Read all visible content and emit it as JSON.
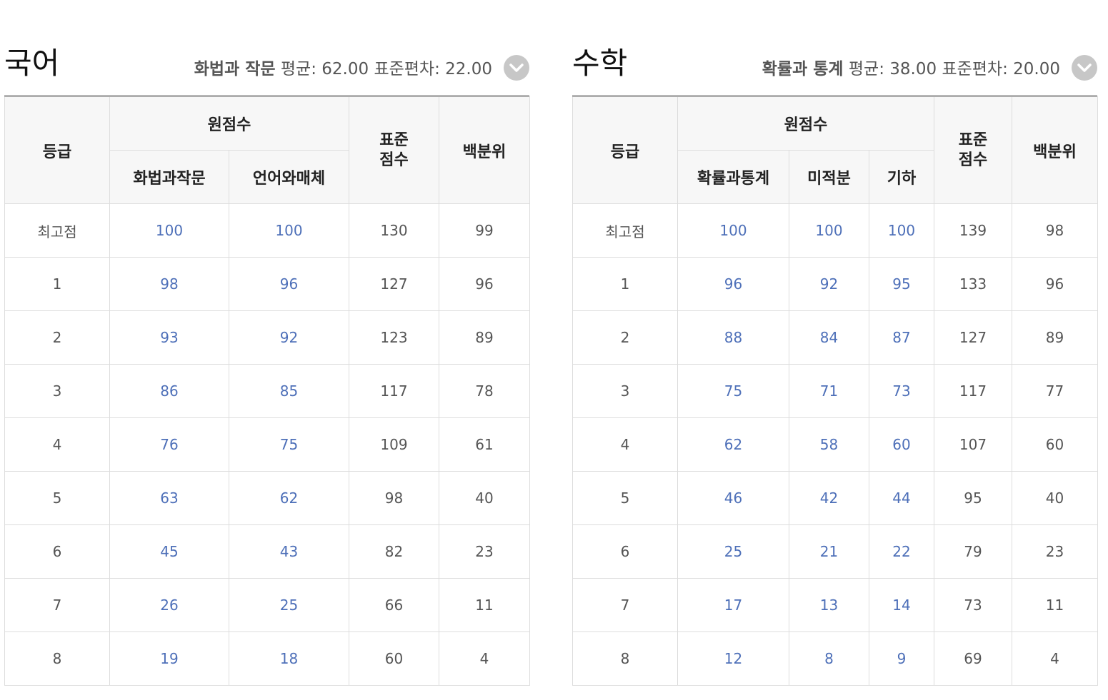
{
  "korean": {
    "title": "국어",
    "elective": "화법과 작문",
    "mean_label": "평균:",
    "mean": "62.00",
    "sd_label": "표준편차:",
    "sd": "22.00",
    "headers": {
      "grade": "등급",
      "raw_score": "원점수",
      "sub_cols": [
        "화법과작문",
        "언어와매체"
      ],
      "std_score_line1": "표준",
      "std_score_line2": "점수",
      "percentile": "백분위"
    },
    "rows": [
      {
        "grade": "최고점",
        "raw": [
          "100",
          "100"
        ],
        "std": "130",
        "pct": "99"
      },
      {
        "grade": "1",
        "raw": [
          "98",
          "96"
        ],
        "std": "127",
        "pct": "96"
      },
      {
        "grade": "2",
        "raw": [
          "93",
          "92"
        ],
        "std": "123",
        "pct": "89"
      },
      {
        "grade": "3",
        "raw": [
          "86",
          "85"
        ],
        "std": "117",
        "pct": "78"
      },
      {
        "grade": "4",
        "raw": [
          "76",
          "75"
        ],
        "std": "109",
        "pct": "61"
      },
      {
        "grade": "5",
        "raw": [
          "63",
          "62"
        ],
        "std": "98",
        "pct": "40"
      },
      {
        "grade": "6",
        "raw": [
          "45",
          "43"
        ],
        "std": "82",
        "pct": "23"
      },
      {
        "grade": "7",
        "raw": [
          "26",
          "25"
        ],
        "std": "66",
        "pct": "11"
      },
      {
        "grade": "8",
        "raw": [
          "19",
          "18"
        ],
        "std": "60",
        "pct": "4"
      }
    ]
  },
  "math": {
    "title": "수학",
    "elective": "확률과 통계",
    "mean_label": "평균:",
    "mean": "38.00",
    "sd_label": "표준편차:",
    "sd": "20.00",
    "headers": {
      "grade": "등급",
      "raw_score": "원점수",
      "sub_cols": [
        "확률과통계",
        "미적분",
        "기하"
      ],
      "std_score_line1": "표준",
      "std_score_line2": "점수",
      "percentile": "백분위"
    },
    "rows": [
      {
        "grade": "최고점",
        "raw": [
          "100",
          "100",
          "100"
        ],
        "std": "139",
        "pct": "98"
      },
      {
        "grade": "1",
        "raw": [
          "96",
          "92",
          "95"
        ],
        "std": "133",
        "pct": "96"
      },
      {
        "grade": "2",
        "raw": [
          "88",
          "84",
          "87"
        ],
        "std": "127",
        "pct": "89"
      },
      {
        "grade": "3",
        "raw": [
          "75",
          "71",
          "73"
        ],
        "std": "117",
        "pct": "77"
      },
      {
        "grade": "4",
        "raw": [
          "62",
          "58",
          "60"
        ],
        "std": "107",
        "pct": "60"
      },
      {
        "grade": "5",
        "raw": [
          "46",
          "42",
          "44"
        ],
        "std": "95",
        "pct": "40"
      },
      {
        "grade": "6",
        "raw": [
          "25",
          "21",
          "22"
        ],
        "std": "79",
        "pct": "23"
      },
      {
        "grade": "7",
        "raw": [
          "17",
          "13",
          "14"
        ],
        "std": "73",
        "pct": "11"
      },
      {
        "grade": "8",
        "raw": [
          "12",
          "8",
          "9"
        ],
        "std": "69",
        "pct": "4"
      }
    ]
  },
  "colors": {
    "raw_score_text": "#4d6fb8",
    "header_bg": "#f7f7f7",
    "border": "#dddddd",
    "dropdown_bg": "#c7c7c7"
  },
  "icons": {
    "dropdown": "chevron-down-icon"
  }
}
